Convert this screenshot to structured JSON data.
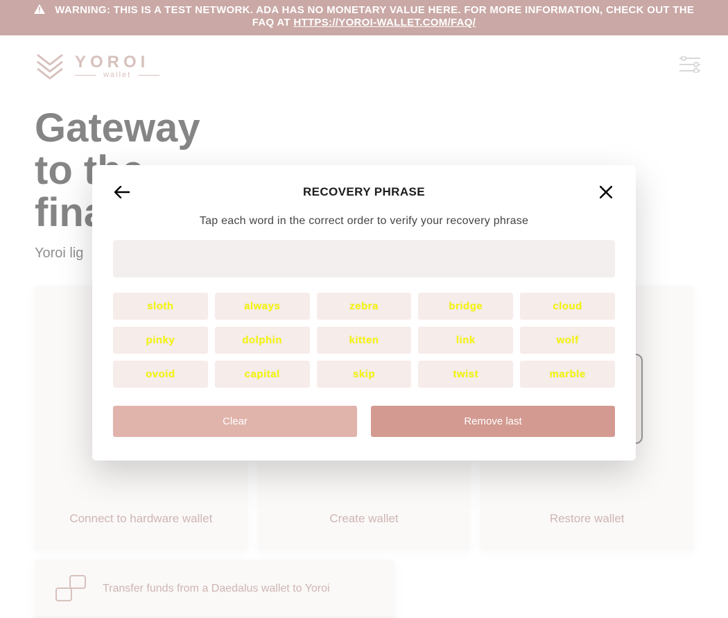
{
  "colors": {
    "warn_bg": "#9d615b",
    "pink_lt": "#f6ece9",
    "pink_md": "#e0b3ab",
    "pink_dk": "#d39a91",
    "yellow": "#f6f707"
  },
  "banner": {
    "text": "WARNING: THIS IS A TEST NETWORK. ADA HAS NO MONETARY VALUE HERE. FOR MORE INFORMATION, CHECK OUT THE FAQ AT ",
    "link_text": "HTTPS://YOROI-WALLET.COM/FAQ/"
  },
  "logo": {
    "brand": "YOROI",
    "sub": "wallet"
  },
  "hero": {
    "line1": "Gateway",
    "line2": "to the",
    "line3": "financial",
    "subtitle": "Yoroi lig"
  },
  "cards": {
    "hardware": "Connect to hardware wallet",
    "create": "Create wallet",
    "restore": "Restore wallet"
  },
  "strip": {
    "label": "Transfer funds from a Daedalus wallet to Yoroi"
  },
  "modal": {
    "title": "RECOVERY PHRASE",
    "sub": "Tap each word in the correct order to verify your recovery phrase",
    "words": [
      "sloth",
      "always",
      "zebra",
      "bridge",
      "cloud",
      "pinky",
      "dolphin",
      "kitten",
      "link",
      "wolf",
      "ovoid",
      "capital",
      "skip",
      "twist",
      "marble"
    ],
    "clear": "Clear",
    "remove": "Remove last"
  }
}
